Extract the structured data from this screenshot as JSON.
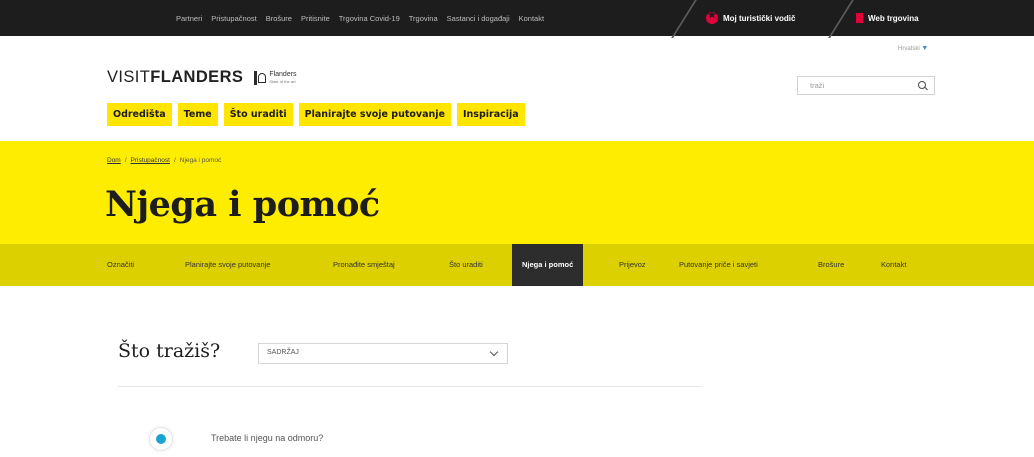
{
  "topbar": {
    "links": [
      "Partneri",
      "Pristupačnost",
      "Brošure",
      "Pritisnite",
      "Trgovina Covid-19",
      "Trgovina",
      "Sastanci i događaji",
      "Kontakt"
    ],
    "my_guide": "Moj turistički vodič",
    "webshop": "Web trgovina"
  },
  "header": {
    "language": "Hrvatski",
    "logo_visit": "VISIT",
    "logo_flanders": "FLANDERS",
    "logo_small_1": "Flanders",
    "logo_small_2": "State of the art",
    "search_placeholder": "traži",
    "nav": [
      "Odredišta",
      "Teme",
      "Što uraditi",
      "Planirajte svoje putovanje",
      "Inspiracija"
    ]
  },
  "hero": {
    "breadcrumb": [
      "Dom",
      "Pristupačnost",
      "Njega i pomoć"
    ],
    "title": "Njega i pomoć",
    "subnav": [
      "Označiti",
      "Planirajte svoje putovanje",
      "Pronađite smještaj",
      "Što uraditi",
      "Njega i pomoć",
      "Prijevoz",
      "Putovanje priče i savjeti",
      "Brošure",
      "Kontakt"
    ],
    "subnav_active": "Njega i pomoć"
  },
  "content": {
    "question": "Što tražiš?",
    "select_value": "SADRŽAJ",
    "item_text": "Trebate li njegu na odmoru?"
  },
  "colors": {
    "yellow": "#ffed00",
    "subnav_yellow": "#ddd000",
    "dark": "#1d1d1d",
    "accent_red": "#e4003a",
    "icon_blue": "#1aa4cf"
  }
}
